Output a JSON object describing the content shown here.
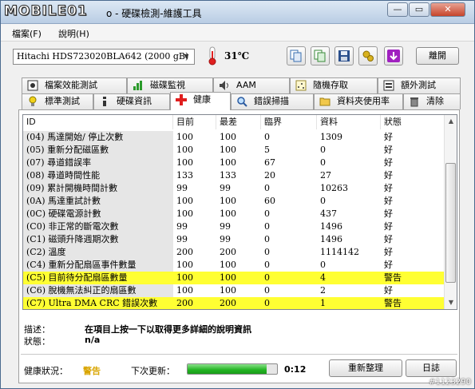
{
  "window": {
    "logo": "MOBILE01",
    "title": "o - 硬碟檢測-維護工具",
    "minimize": "—",
    "maximize": "▭",
    "close": "✕"
  },
  "menu": [
    "檔案(F)",
    "說明(H)"
  ],
  "toolbar": {
    "drive": "Hitachi HDS723020BLA642 (2000 gB)",
    "temperature": "31℃",
    "exit_label": "離開"
  },
  "tabs_top": [
    {
      "label": "檔案效能測試",
      "icon": "file-benchmark-icon"
    },
    {
      "label": "磁碟監視",
      "icon": "disk-monitor-icon"
    },
    {
      "label": "AAM",
      "icon": "speaker-icon"
    },
    {
      "label": "隨機存取",
      "icon": "random-access-icon"
    },
    {
      "label": "額外測試",
      "icon": "extra-tests-icon"
    }
  ],
  "tabs_bottom": [
    {
      "label": "標準測試",
      "icon": "lightbulb-icon"
    },
    {
      "label": "硬碟資訊",
      "icon": "disk-info-icon"
    },
    {
      "label": "健康",
      "icon": "health-cross-icon",
      "active": true
    },
    {
      "label": "錯誤掃描",
      "icon": "error-scan-icon"
    },
    {
      "label": "資料夾使用率",
      "icon": "folder-icon"
    },
    {
      "label": "清除",
      "icon": "trash-icon"
    }
  ],
  "table": {
    "columns": [
      "ID",
      "目前",
      "最差",
      "臨界",
      "資料",
      "狀態"
    ],
    "rows": [
      {
        "id": "(04) 馬達開始/ 停止次數",
        "current": "100",
        "worst": "100",
        "threshold": "0",
        "data": "1309",
        "status": "好",
        "warn": false
      },
      {
        "id": "(05) 重新分配磁區數",
        "current": "100",
        "worst": "100",
        "threshold": "5",
        "data": "0",
        "status": "好",
        "warn": false
      },
      {
        "id": "(07) 尋道錯誤率",
        "current": "100",
        "worst": "100",
        "threshold": "67",
        "data": "0",
        "status": "好",
        "warn": false
      },
      {
        "id": "(08) 尋道時間性能",
        "current": "133",
        "worst": "133",
        "threshold": "20",
        "data": "27",
        "status": "好",
        "warn": false
      },
      {
        "id": "(09) 累計開機時間計數",
        "current": "99",
        "worst": "99",
        "threshold": "0",
        "data": "10263",
        "status": "好",
        "warn": false
      },
      {
        "id": "(0A) 馬達重試計數",
        "current": "100",
        "worst": "100",
        "threshold": "60",
        "data": "0",
        "status": "好",
        "warn": false
      },
      {
        "id": "(0C) 硬碟電源計數",
        "current": "100",
        "worst": "100",
        "threshold": "0",
        "data": "437",
        "status": "好",
        "warn": false
      },
      {
        "id": "(C0) 非正常的斷電次數",
        "current": "99",
        "worst": "99",
        "threshold": "0",
        "data": "1496",
        "status": "好",
        "warn": false
      },
      {
        "id": "(C1) 磁頭升降週期次數",
        "current": "99",
        "worst": "99",
        "threshold": "0",
        "data": "1496",
        "status": "好",
        "warn": false
      },
      {
        "id": "(C2) 溫度",
        "current": "200",
        "worst": "200",
        "threshold": "0",
        "data": "1114142",
        "status": "好",
        "warn": false
      },
      {
        "id": "(C4) 重新分配扇區事件數量",
        "current": "100",
        "worst": "100",
        "threshold": "0",
        "data": "0",
        "status": "好",
        "warn": false
      },
      {
        "id": "(C5) 目前待分配扇區數量",
        "current": "100",
        "worst": "100",
        "threshold": "0",
        "data": "4",
        "status": "警告",
        "warn": true
      },
      {
        "id": "(C6) 脫機無法糾正的扇區數",
        "current": "100",
        "worst": "100",
        "threshold": "0",
        "data": "2",
        "status": "好",
        "warn": false
      },
      {
        "id": "(C7) Ultra DMA CRC 錯誤次數",
        "current": "200",
        "worst": "200",
        "threshold": "0",
        "data": "1",
        "status": "警告",
        "warn": true
      }
    ]
  },
  "details": {
    "desc_label": "描述：",
    "desc_value": "在項目上按一下以取得更多詳細的說明資訊",
    "status_label": "狀態：",
    "status_value": "n/a"
  },
  "footer": {
    "health_label": "健康狀況：",
    "health_value": "警告",
    "next_update_label": "下次更新：",
    "progress": 0.88,
    "countdown": "0:12",
    "recheck_label": "重新整理",
    "log_label": "日誌"
  },
  "watermark": "#1123290",
  "colors": {
    "warn_row": "#ffff33",
    "warn_text": "#d9a500",
    "progress": "#22b322"
  }
}
